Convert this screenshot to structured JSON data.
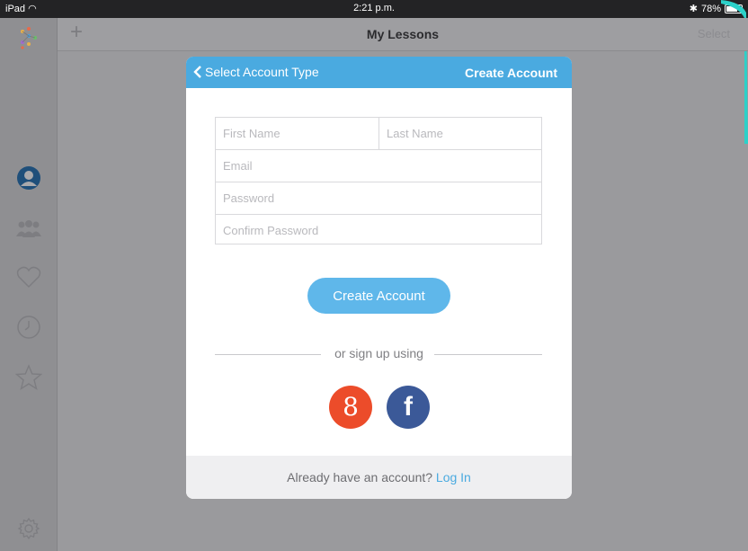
{
  "status_bar": {
    "device": "iPad",
    "time": "2:21 p.m.",
    "battery": "78%"
  },
  "navbar": {
    "add_label": "+",
    "title": "My Lessons",
    "select_label": "Select"
  },
  "modal": {
    "back_label": "Select Account Type",
    "title": "Create Account",
    "fields": {
      "first_name_placeholder": "First Name",
      "last_name_placeholder": "Last Name",
      "email_placeholder": "Email",
      "password_placeholder": "Password",
      "confirm_password_placeholder": "Confirm Password"
    },
    "create_button": "Create Account",
    "or_text": "or sign up using",
    "google_glyph": "8",
    "facebook_glyph": "f",
    "footer_text": "Already have an account?",
    "login_link": "Log In"
  },
  "colors": {
    "accent": "#4aaae0",
    "google": "#ec4c2a",
    "facebook": "#3b5998"
  }
}
